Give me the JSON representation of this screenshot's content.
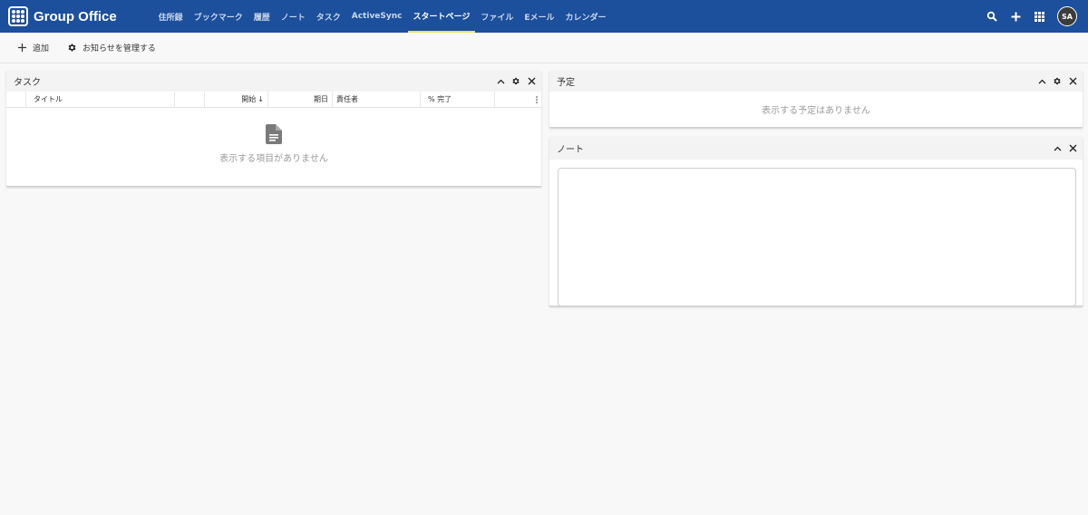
{
  "app": {
    "title": "Group Office"
  },
  "nav": {
    "items": [
      {
        "label": "住所録",
        "active": false
      },
      {
        "label": "ブックマーク",
        "active": false
      },
      {
        "label": "履歴",
        "active": false
      },
      {
        "label": "ノート",
        "active": false
      },
      {
        "label": "タスク",
        "active": false
      },
      {
        "label": "ActiveSync",
        "active": false
      },
      {
        "label": "スタートページ",
        "active": true
      },
      {
        "label": "ファイル",
        "active": false
      },
      {
        "label": "Eメール",
        "active": false
      },
      {
        "label": "カレンダー",
        "active": false
      }
    ]
  },
  "header_actions": {
    "icons": [
      "search-icon",
      "plus-icon",
      "apps-grid-icon"
    ],
    "avatar_initials": "SA"
  },
  "toolbar": {
    "add_label": "追加",
    "manage_label": "お知らせを管理する"
  },
  "tasks_panel": {
    "title": "タスク",
    "columns": [
      "",
      "タイトル",
      "",
      "開始",
      "期日",
      "責任者",
      "% 完了",
      ""
    ],
    "sort_indicator": "↓",
    "empty_text": "表示する項目がありません"
  },
  "schedule_panel": {
    "title": "予定",
    "empty_text": "表示する予定はありません"
  },
  "notes_panel": {
    "title": "ノート",
    "content": ""
  },
  "colors": {
    "topbar": "#1c4f9c",
    "active_tab_underline": "#f0e15a",
    "background": "#f8f8f8"
  }
}
